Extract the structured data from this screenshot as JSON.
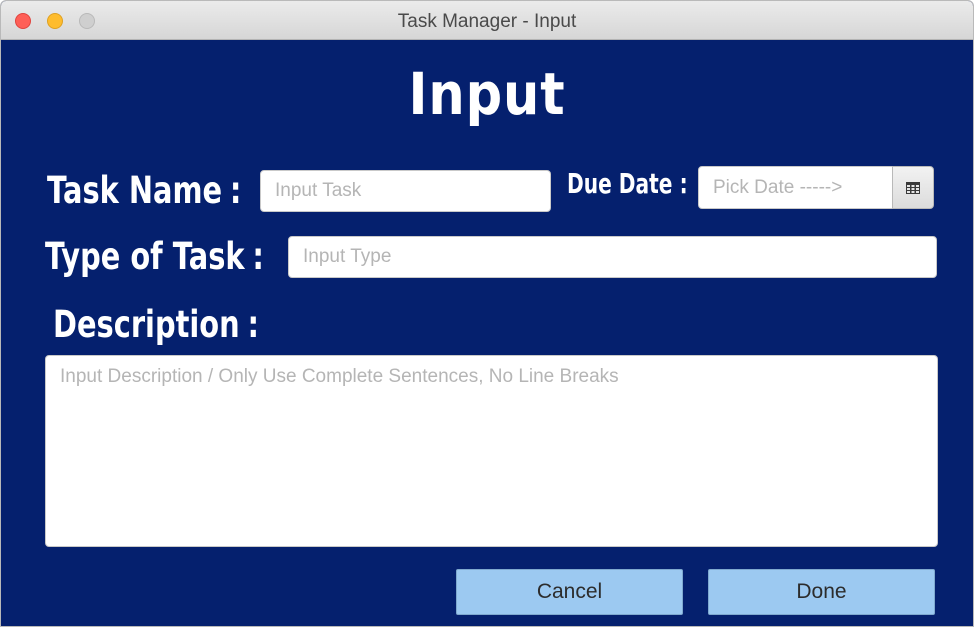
{
  "window": {
    "title": "Task Manager - Input"
  },
  "form": {
    "heading": "Input",
    "task_name": {
      "label": "Task Name",
      "placeholder": "Input Task",
      "value": ""
    },
    "due_date": {
      "label": "Due Date",
      "placeholder": "Pick Date ----->",
      "value": "",
      "button_icon": "calendar-icon"
    },
    "task_type": {
      "label": "Type of Task",
      "placeholder": "Input Type",
      "value": ""
    },
    "description": {
      "label": "Description",
      "placeholder": "Input Description / Only Use Complete Sentences, No Line Breaks",
      "value": ""
    },
    "colon": ":"
  },
  "buttons": {
    "cancel_label": "Cancel",
    "done_label": "Done"
  },
  "colors": {
    "background": "#05206e",
    "button": "#9cc9f1",
    "label_text": "#ffffff"
  }
}
